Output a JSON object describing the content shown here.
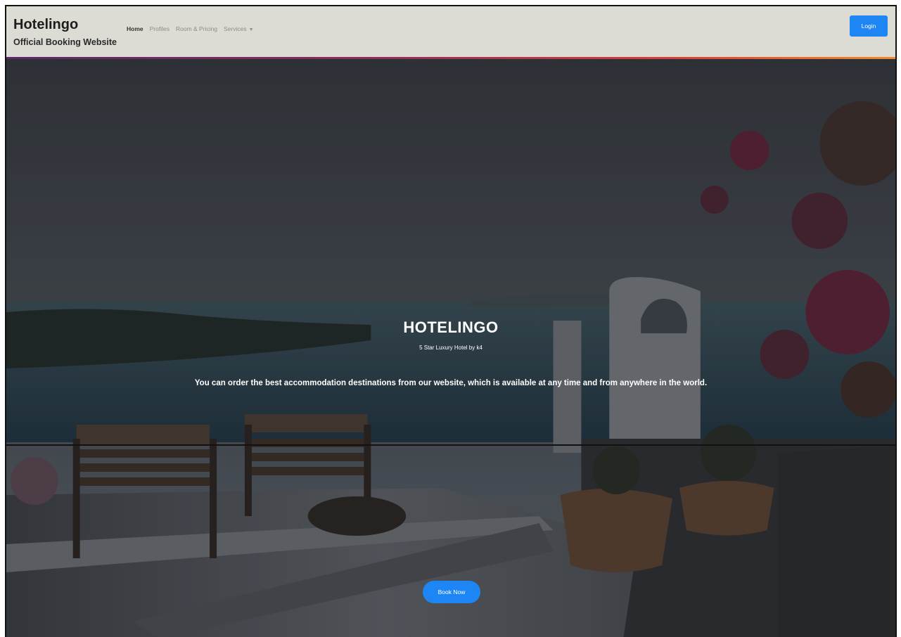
{
  "navbar": {
    "brand_title": "Hotelingo",
    "brand_subtitle": "Official Booking Website",
    "links": [
      {
        "label": "Home",
        "active": true
      },
      {
        "label": "Profiles",
        "active": false
      },
      {
        "label": "Room & Pricing",
        "active": false
      },
      {
        "label": "Services",
        "active": false,
        "dropdown": true
      }
    ],
    "login_label": "Login"
  },
  "hero": {
    "title": "HOTELINGO",
    "subtitle": "5 Star Luxury Hotel by k4",
    "description": "You can order the best accommodation destinations from our website, which is available at any time and from anywhere in the world.",
    "cta_label": "Book Now"
  },
  "colors": {
    "primary": "#1e85f5",
    "navbar_bg": "#dcdcd4",
    "accent_gradient": [
      "#5a2a6a",
      "#8b2d5a",
      "#d8403a",
      "#f08a2a"
    ]
  }
}
